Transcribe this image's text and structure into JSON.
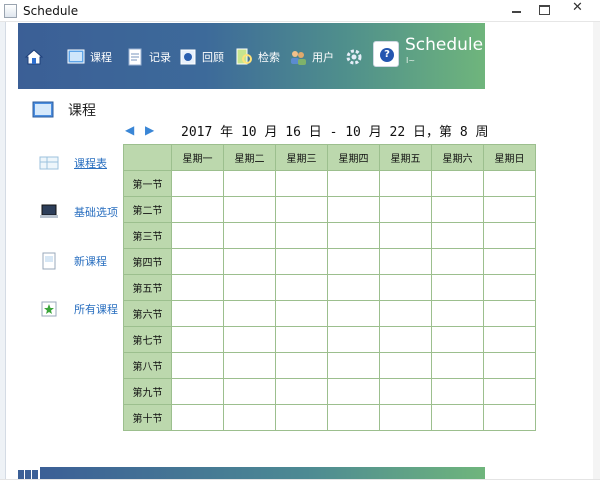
{
  "window": {
    "title": "Schedule",
    "close_glyph": "✕"
  },
  "toolbar": {
    "items": [
      {
        "label": "课程",
        "icon": "book-icon"
      },
      {
        "label": "记录",
        "icon": "document-icon"
      },
      {
        "label": "回顾",
        "icon": "review-icon"
      },
      {
        "label": "检索",
        "icon": "search-icon"
      },
      {
        "label": "用户",
        "icon": "users-icon"
      }
    ],
    "home_icon": "home-icon",
    "settings_icon": "gear-icon"
  },
  "brand": {
    "title": "Schedule",
    "subtitle": "I~"
  },
  "sidebar": {
    "title": "课程",
    "items": [
      {
        "label": "课程表",
        "icon": "table-icon",
        "active": true
      },
      {
        "label": "基础选项",
        "icon": "laptop-icon"
      },
      {
        "label": "新课程",
        "icon": "new-document-icon"
      },
      {
        "label": "所有课程",
        "icon": "star-document-icon"
      }
    ]
  },
  "week": {
    "text": "2017 年 10 月 16 日 - 10 月 22 日，第 8 周",
    "prev_glyph": "◀",
    "next_glyph": "▶"
  },
  "schedule": {
    "days": [
      "星期一",
      "星期二",
      "星期三",
      "星期四",
      "星期五",
      "星期六",
      "星期日"
    ],
    "periods": [
      "第一节",
      "第二节",
      "第三节",
      "第四节",
      "第五节",
      "第六节",
      "第七节",
      "第八节",
      "第九节",
      "第十节"
    ]
  },
  "colors": {
    "grid_header": "#bcd8ad",
    "grid_border": "#9cbf8e",
    "banner_start": "#3b5f96",
    "banner_end": "#6fb57c",
    "link": "#2a6fc0"
  }
}
